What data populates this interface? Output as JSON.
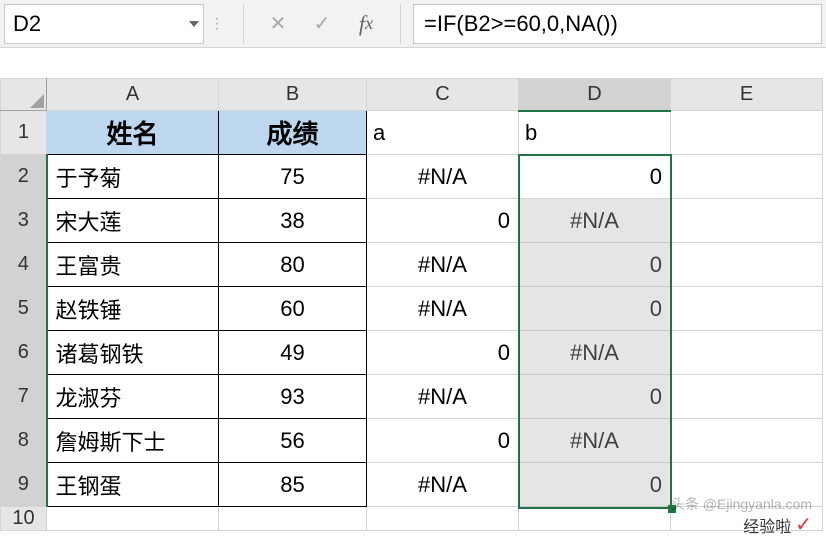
{
  "name_box": "D2",
  "formula": "=IF(B2>=60,0,NA())",
  "columns": [
    "A",
    "B",
    "C",
    "D",
    "E"
  ],
  "rows": [
    "1",
    "2",
    "3",
    "4",
    "5",
    "6",
    "7",
    "8",
    "9",
    "10"
  ],
  "headers": {
    "A": "姓名",
    "B": "成绩"
  },
  "labels": {
    "c1": "a",
    "d1": "b"
  },
  "data": [
    {
      "name": "于予菊",
      "score": "75",
      "c": "#N/A",
      "d": "0",
      "cnum": false,
      "dnum": true
    },
    {
      "name": "宋大莲",
      "score": "38",
      "c": "0",
      "d": "#N/A",
      "cnum": true,
      "dnum": false
    },
    {
      "name": "王富贵",
      "score": "80",
      "c": "#N/A",
      "d": "0",
      "cnum": false,
      "dnum": true
    },
    {
      "name": "赵铁锤",
      "score": "60",
      "c": "#N/A",
      "d": "0",
      "cnum": false,
      "dnum": true
    },
    {
      "name": "诸葛钢铁",
      "score": "49",
      "c": "0",
      "d": "#N/A",
      "cnum": true,
      "dnum": false
    },
    {
      "name": "龙淑芬",
      "score": "93",
      "c": "#N/A",
      "d": "0",
      "cnum": false,
      "dnum": true
    },
    {
      "name": "詹姆斯下士",
      "score": "56",
      "c": "0",
      "d": "#N/A",
      "cnum": true,
      "dnum": false
    },
    {
      "name": "王钢蛋",
      "score": "85",
      "c": "#N/A",
      "d": "0",
      "cnum": false,
      "dnum": true
    }
  ],
  "watermark1": "经验啦",
  "watermark2": "头条 @Ejingyanla.com",
  "chart_data": {
    "type": "table",
    "title": "",
    "columns": [
      "姓名",
      "成绩",
      "a",
      "b"
    ],
    "rows": [
      [
        "于予菊",
        75,
        "#N/A",
        0
      ],
      [
        "宋大莲",
        38,
        0,
        "#N/A"
      ],
      [
        "王富贵",
        80,
        "#N/A",
        0
      ],
      [
        "赵铁锤",
        60,
        "#N/A",
        0
      ],
      [
        "诸葛钢铁",
        49,
        0,
        "#N/A"
      ],
      [
        "龙淑芬",
        93,
        "#N/A",
        0
      ],
      [
        "詹姆斯下士",
        56,
        0,
        "#N/A"
      ],
      [
        "王钢蛋",
        85,
        "#N/A",
        0
      ]
    ]
  }
}
